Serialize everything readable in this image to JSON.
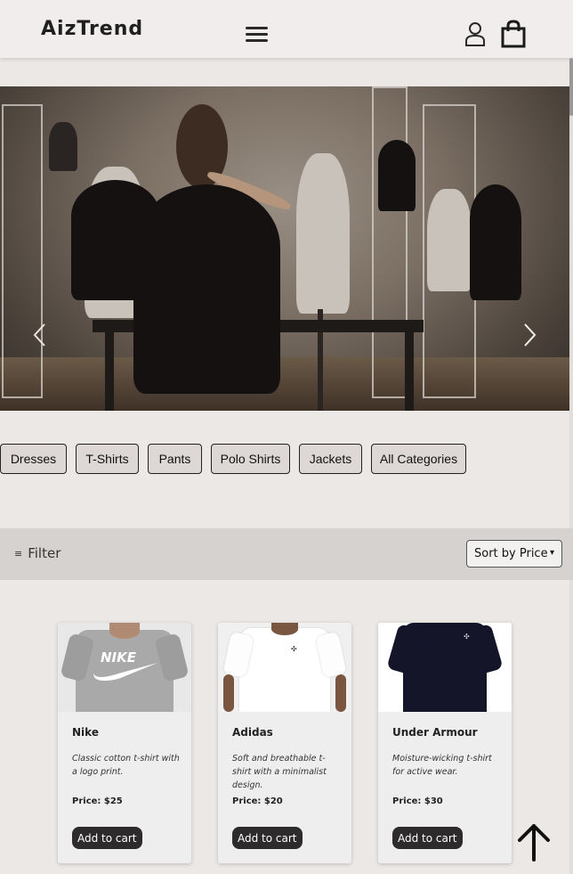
{
  "header": {
    "logo": "AizTrend",
    "menu_icon": "hamburger-menu-icon",
    "user_icon": "user-icon",
    "cart_icon": "shopping-bag-icon"
  },
  "hero": {
    "prev_icon": "chevron-left-icon",
    "next_icon": "chevron-right-icon"
  },
  "categories": [
    "Dresses",
    "T-Shirts",
    "Pants",
    "Polo Shirts",
    "Jackets",
    "All Categories"
  ],
  "filter": {
    "label": "Filter",
    "icon": "filter-sliders-icon",
    "sort_selected": "Sort by Price"
  },
  "products": [
    {
      "name": "Nike",
      "description": "Classic cotton t-shirt with a logo print.",
      "price": "Price: $25",
      "button": "Add to cart",
      "shirt_color": "#a9a9a9"
    },
    {
      "name": "Adidas",
      "description": "Soft and breathable t-shirt with a minimalist design.",
      "price": "Price: $20",
      "button": "Add to cart",
      "shirt_color": "#ffffff"
    },
    {
      "name": "Under Armour",
      "description": "Moisture-wicking t-shirt for active wear.",
      "price": "Price: $30",
      "button": "Add to cart",
      "shirt_color": "#15152a"
    }
  ],
  "back_to_top_icon": "arrow-up-icon"
}
